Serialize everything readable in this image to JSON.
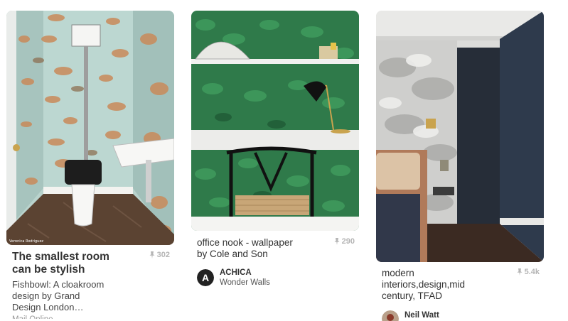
{
  "pins": [
    {
      "image_alt": "Cloakroom with fish wallpaper and high-level cistern toilet",
      "watermark": "Veronica Rodriguez",
      "title": "The smallest room can be stylish",
      "title_line1": "The smallest room",
      "title_line2": "can be stylish",
      "save_count": "302",
      "desc_line1": "Fishbowl: A cloakroom",
      "desc_line2": "design by Grand",
      "desc_line3": "Design London…",
      "cut_text": "Mail Online"
    },
    {
      "image_alt": "Office nook with green leaf wallpaper, black lamp and wishbone chair",
      "title_line1": "office nook - wallpaper",
      "title_line2": "by Cole and Son",
      "save_count": "290",
      "pinner_initial": "A",
      "pinner_name": "ACHICA",
      "board_name": "Wonder Walls"
    },
    {
      "image_alt": "Bedroom with cloud toile wallpaper and dark blue wall",
      "title_line1": "modern",
      "title_line2": "interiors,design,mid",
      "title_line3": "century, TFAD",
      "save_count": "5.4k",
      "pinner_name": "Neil Watt"
    }
  ],
  "colors": {
    "text": "#333333",
    "count": "#b5b5b5",
    "fish_wall": "#a9c9c3",
    "leaf_green": "#2f7a4a",
    "navy_wall": "#2e3a4c"
  },
  "icons": [
    "pin-icon",
    "avatar"
  ]
}
